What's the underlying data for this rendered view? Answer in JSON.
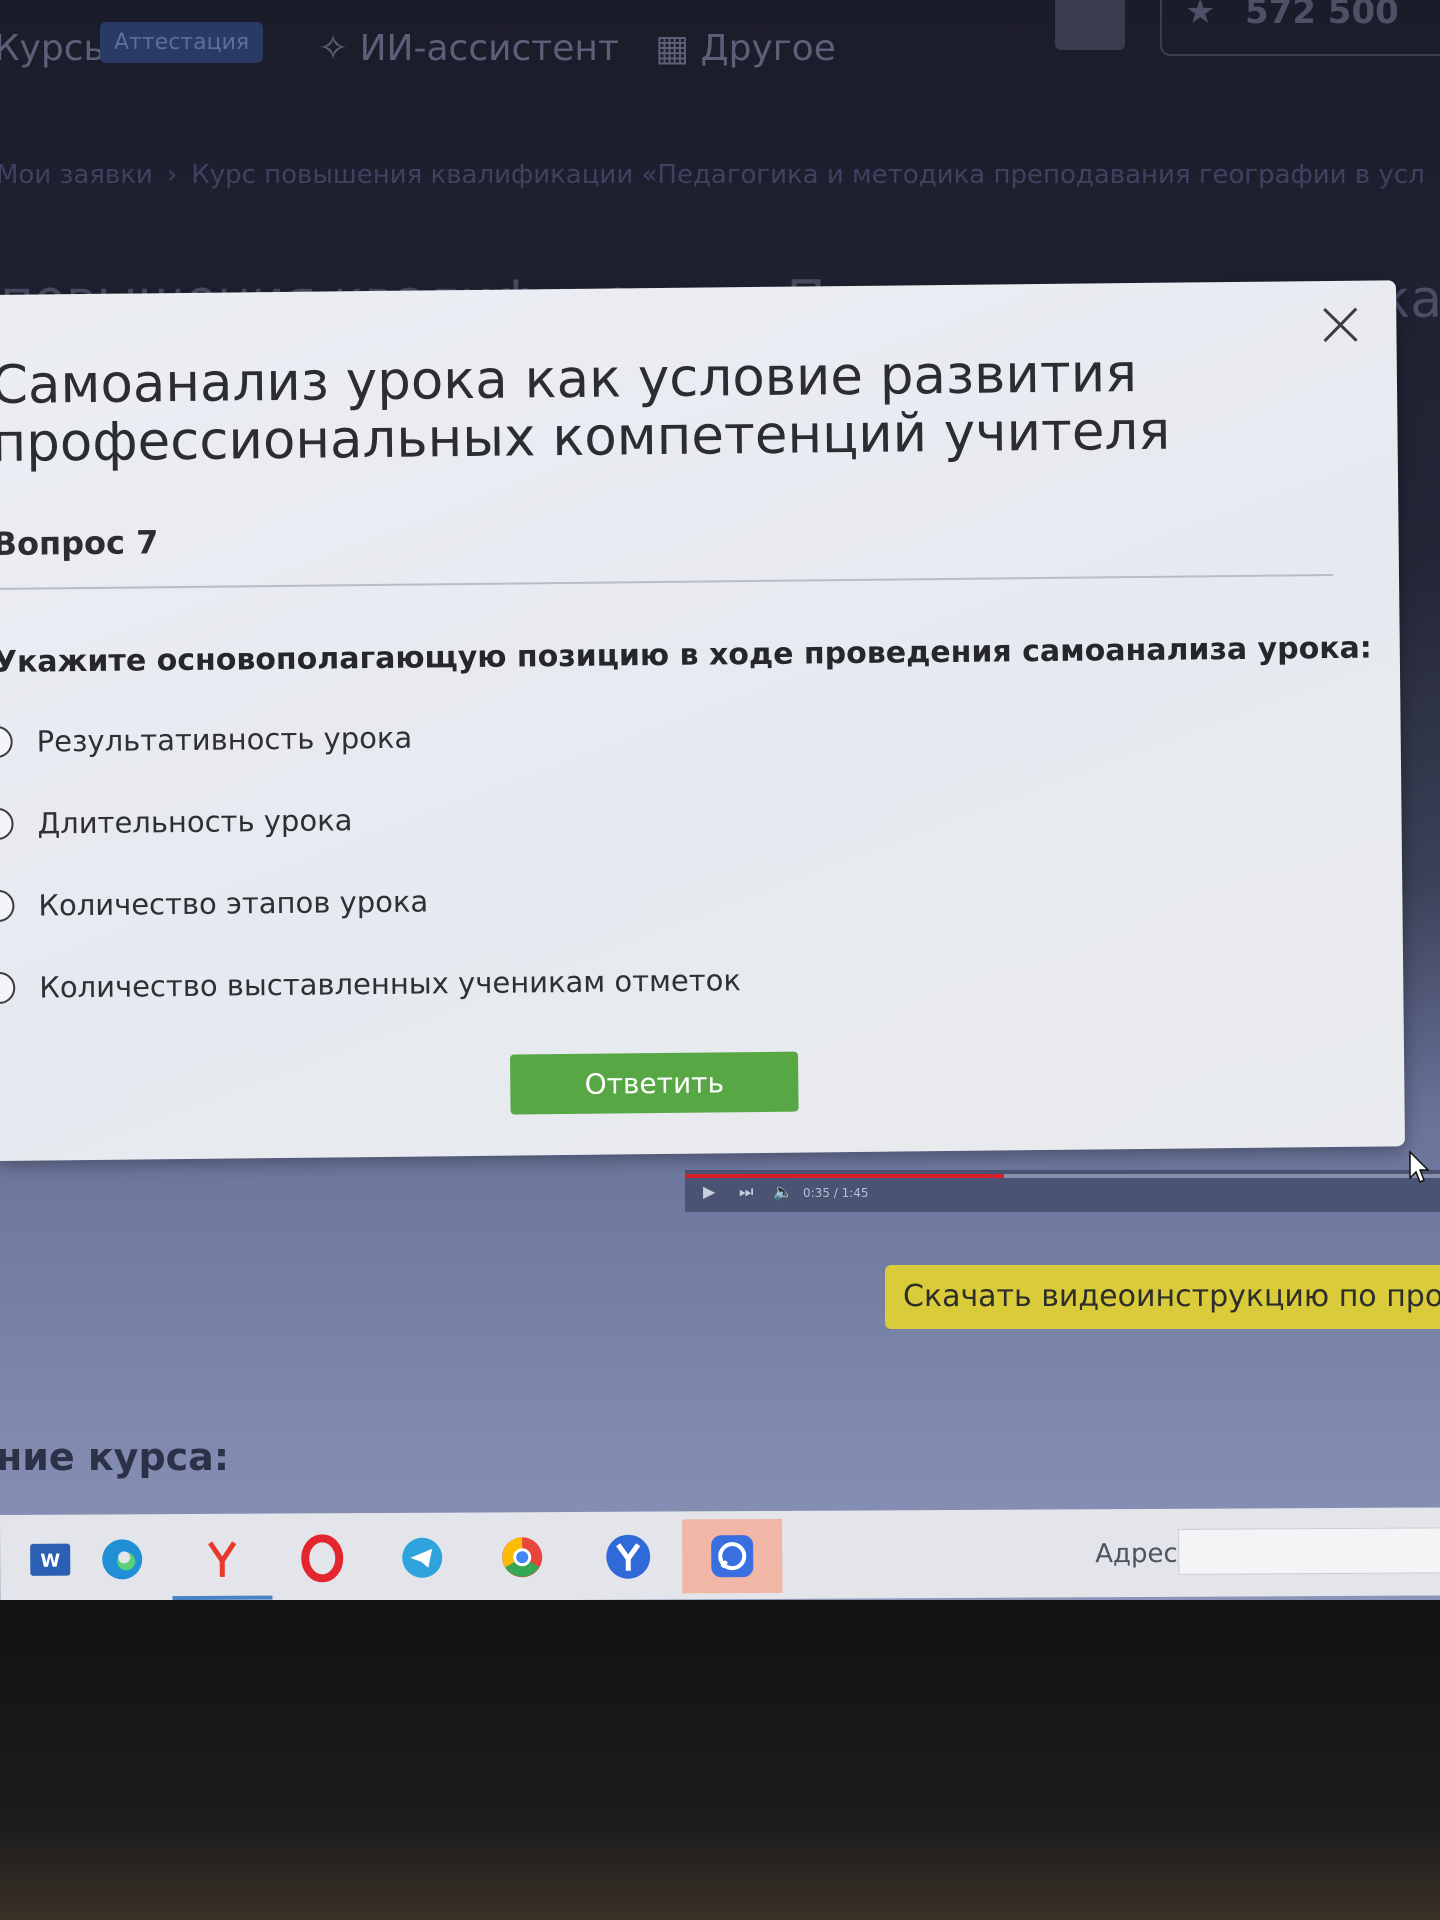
{
  "nav": {
    "courses": "Курсы",
    "attestation_badge": "Аттестация",
    "ai_assistant": "ИИ-ассистент",
    "other": "Другое",
    "score": "572 500"
  },
  "breadcrumb": {
    "my_requests": "Мои заявки",
    "current": "Курс повышения квалификации «Педагогика и методика преподавания географии в усл"
  },
  "background_heading": "повышения квалификации «Педагогика и методика",
  "modal": {
    "title": "Самоанализ урока как условие развития профессиональных компетенций учителя",
    "question_label": "Вопрос 7",
    "question_text": "Укажите основополагающую позицию в ходе проведения самоанализа урока:",
    "options": [
      "Результативность урока",
      "Длительность урока",
      "Количество этапов урока",
      "Количество выставленных ученикам отметок"
    ],
    "answer_button": "Ответить"
  },
  "video": {
    "time": "0:35 / 1:45",
    "progress": 0.42
  },
  "download_button": "Скачать видеоинструкцию по прохо",
  "course_section_label": "ние курса:",
  "taskbar": {
    "address_label": "Адрес",
    "icons": [
      "word-icon",
      "edge-icon",
      "yandex-browser-icon",
      "opera-icon",
      "telegram-icon",
      "chrome-icon",
      "yandex-icon",
      "chat-app-icon"
    ]
  },
  "colors": {
    "accent_green": "#58a745",
    "download_yellow": "#d9cb3a",
    "video_progress_red": "#d5202a"
  }
}
